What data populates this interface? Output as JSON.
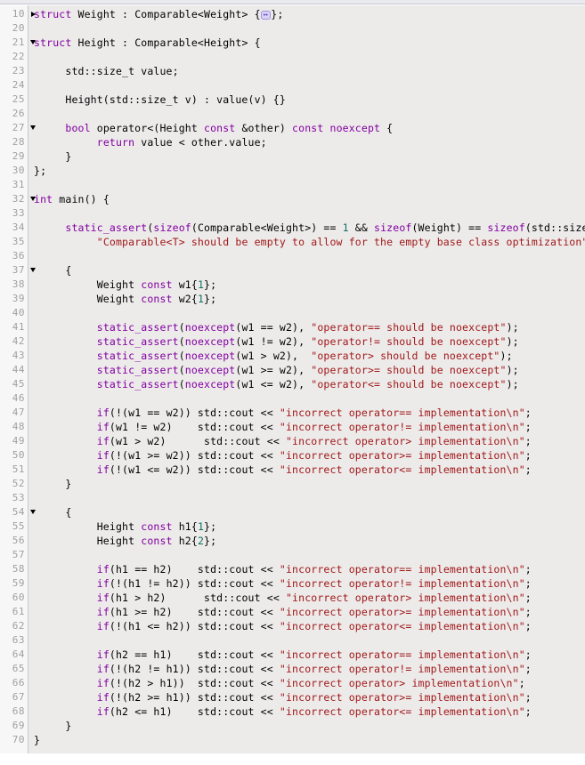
{
  "editor": {
    "language": "C++",
    "gutter_bg": "#f7f7f7",
    "code_bg": "#edeaea",
    "keyword_color": "#8000a0",
    "string_color": "#a01818",
    "number_color": "#0b7360",
    "plain_color": "#000000",
    "line_number_color": "#a0a0a0",
    "fold_chip_glyph": "↔"
  },
  "lines": [
    {
      "n": "10",
      "fold": "collapsed",
      "tokens": [
        {
          "t": "kw",
          "s": "struct"
        },
        {
          "t": "pl",
          "s": " Weight : Comparable<Weight> {"
        },
        {
          "t": "foldchip",
          "s": "↔"
        },
        {
          "t": "pl",
          "s": "};"
        }
      ]
    },
    {
      "n": "20",
      "fold": "none",
      "tokens": []
    },
    {
      "n": "21",
      "fold": "expanded",
      "tokens": [
        {
          "t": "kw",
          "s": "struct"
        },
        {
          "t": "pl",
          "s": " Height : Comparable<Height> {"
        }
      ]
    },
    {
      "n": "22",
      "fold": "none",
      "tokens": []
    },
    {
      "n": "23",
      "fold": "none",
      "tokens": [
        {
          "t": "pl",
          "s": "     std::size_t value;"
        }
      ]
    },
    {
      "n": "24",
      "fold": "none",
      "tokens": []
    },
    {
      "n": "25",
      "fold": "none",
      "tokens": [
        {
          "t": "pl",
          "s": "     Height(std::size_t v) : value(v) {}"
        }
      ]
    },
    {
      "n": "26",
      "fold": "none",
      "tokens": []
    },
    {
      "n": "27",
      "fold": "expanded",
      "tokens": [
        {
          "t": "pl",
          "s": "     "
        },
        {
          "t": "kw",
          "s": "bool"
        },
        {
          "t": "pl",
          "s": " operator<(Height "
        },
        {
          "t": "kw",
          "s": "const"
        },
        {
          "t": "pl",
          "s": " &other) "
        },
        {
          "t": "kw",
          "s": "const"
        },
        {
          "t": "pl",
          "s": " "
        },
        {
          "t": "kw",
          "s": "noexcept"
        },
        {
          "t": "pl",
          "s": " {"
        }
      ]
    },
    {
      "n": "28",
      "fold": "none",
      "tokens": [
        {
          "t": "pl",
          "s": "          "
        },
        {
          "t": "kw",
          "s": "return"
        },
        {
          "t": "pl",
          "s": " value < other.value;"
        }
      ]
    },
    {
      "n": "29",
      "fold": "none",
      "tokens": [
        {
          "t": "pl",
          "s": "     }"
        }
      ]
    },
    {
      "n": "30",
      "fold": "none",
      "tokens": [
        {
          "t": "pl",
          "s": "};"
        }
      ]
    },
    {
      "n": "31",
      "fold": "none",
      "tokens": []
    },
    {
      "n": "32",
      "fold": "expanded",
      "tokens": [
        {
          "t": "kw",
          "s": "int"
        },
        {
          "t": "pl",
          "s": " main() {"
        }
      ]
    },
    {
      "n": "33",
      "fold": "none",
      "tokens": []
    },
    {
      "n": "34",
      "fold": "none",
      "tokens": [
        {
          "t": "pl",
          "s": "     "
        },
        {
          "t": "kw",
          "s": "static_assert"
        },
        {
          "t": "pl",
          "s": "("
        },
        {
          "t": "kw",
          "s": "sizeof"
        },
        {
          "t": "pl",
          "s": "(Comparable<Weight>) == "
        },
        {
          "t": "num",
          "s": "1"
        },
        {
          "t": "pl",
          "s": " && "
        },
        {
          "t": "kw",
          "s": "sizeof"
        },
        {
          "t": "pl",
          "s": "(Weight) == "
        },
        {
          "t": "kw",
          "s": "sizeof"
        },
        {
          "t": "pl",
          "s": "(std::size_t),"
        }
      ]
    },
    {
      "n": "35",
      "fold": "none",
      "tokens": [
        {
          "t": "pl",
          "s": "          "
        },
        {
          "t": "str",
          "s": "\"Comparable<T> should be empty to allow for the empty base class optimization\""
        },
        {
          "t": "pl",
          "s": ");"
        }
      ]
    },
    {
      "n": "36",
      "fold": "none",
      "tokens": []
    },
    {
      "n": "37",
      "fold": "expanded",
      "tokens": [
        {
          "t": "pl",
          "s": "     {"
        }
      ]
    },
    {
      "n": "38",
      "fold": "none",
      "tokens": [
        {
          "t": "pl",
          "s": "          Weight "
        },
        {
          "t": "kw",
          "s": "const"
        },
        {
          "t": "pl",
          "s": " w1{"
        },
        {
          "t": "num",
          "s": "1"
        },
        {
          "t": "pl",
          "s": "};"
        }
      ]
    },
    {
      "n": "39",
      "fold": "none",
      "tokens": [
        {
          "t": "pl",
          "s": "          Weight "
        },
        {
          "t": "kw",
          "s": "const"
        },
        {
          "t": "pl",
          "s": " w2{"
        },
        {
          "t": "num",
          "s": "1"
        },
        {
          "t": "pl",
          "s": "};"
        }
      ]
    },
    {
      "n": "40",
      "fold": "none",
      "tokens": []
    },
    {
      "n": "41",
      "fold": "none",
      "tokens": [
        {
          "t": "pl",
          "s": "          "
        },
        {
          "t": "kw",
          "s": "static_assert"
        },
        {
          "t": "pl",
          "s": "("
        },
        {
          "t": "kw",
          "s": "noexcept"
        },
        {
          "t": "pl",
          "s": "(w1 == w2), "
        },
        {
          "t": "str",
          "s": "\"operator== should be noexcept\""
        },
        {
          "t": "pl",
          "s": ");"
        }
      ]
    },
    {
      "n": "42",
      "fold": "none",
      "tokens": [
        {
          "t": "pl",
          "s": "          "
        },
        {
          "t": "kw",
          "s": "static_assert"
        },
        {
          "t": "pl",
          "s": "("
        },
        {
          "t": "kw",
          "s": "noexcept"
        },
        {
          "t": "pl",
          "s": "(w1 != w2), "
        },
        {
          "t": "str",
          "s": "\"operator!= should be noexcept\""
        },
        {
          "t": "pl",
          "s": ");"
        }
      ]
    },
    {
      "n": "43",
      "fold": "none",
      "tokens": [
        {
          "t": "pl",
          "s": "          "
        },
        {
          "t": "kw",
          "s": "static_assert"
        },
        {
          "t": "pl",
          "s": "("
        },
        {
          "t": "kw",
          "s": "noexcept"
        },
        {
          "t": "pl",
          "s": "(w1 > w2),  "
        },
        {
          "t": "str",
          "s": "\"operator> should be noexcept\""
        },
        {
          "t": "pl",
          "s": ");"
        }
      ]
    },
    {
      "n": "44",
      "fold": "none",
      "tokens": [
        {
          "t": "pl",
          "s": "          "
        },
        {
          "t": "kw",
          "s": "static_assert"
        },
        {
          "t": "pl",
          "s": "("
        },
        {
          "t": "kw",
          "s": "noexcept"
        },
        {
          "t": "pl",
          "s": "(w1 >= w2), "
        },
        {
          "t": "str",
          "s": "\"operator>= should be noexcept\""
        },
        {
          "t": "pl",
          "s": ");"
        }
      ]
    },
    {
      "n": "45",
      "fold": "none",
      "tokens": [
        {
          "t": "pl",
          "s": "          "
        },
        {
          "t": "kw",
          "s": "static_assert"
        },
        {
          "t": "pl",
          "s": "("
        },
        {
          "t": "kw",
          "s": "noexcept"
        },
        {
          "t": "pl",
          "s": "(w1 <= w2), "
        },
        {
          "t": "str",
          "s": "\"operator<= should be noexcept\""
        },
        {
          "t": "pl",
          "s": ");"
        }
      ]
    },
    {
      "n": "46",
      "fold": "none",
      "tokens": []
    },
    {
      "n": "47",
      "fold": "none",
      "tokens": [
        {
          "t": "pl",
          "s": "          "
        },
        {
          "t": "kw",
          "s": "if"
        },
        {
          "t": "pl",
          "s": "(!(w1 == w2)) std::cout << "
        },
        {
          "t": "str",
          "s": "\"incorrect operator== implementation\\n\""
        },
        {
          "t": "pl",
          "s": ";"
        }
      ]
    },
    {
      "n": "48",
      "fold": "none",
      "tokens": [
        {
          "t": "pl",
          "s": "          "
        },
        {
          "t": "kw",
          "s": "if"
        },
        {
          "t": "pl",
          "s": "(w1 != w2)    std::cout << "
        },
        {
          "t": "str",
          "s": "\"incorrect operator!= implementation\\n\""
        },
        {
          "t": "pl",
          "s": ";"
        }
      ]
    },
    {
      "n": "49",
      "fold": "none",
      "tokens": [
        {
          "t": "pl",
          "s": "          "
        },
        {
          "t": "kw",
          "s": "if"
        },
        {
          "t": "pl",
          "s": "(w1 > w2)      std::cout << "
        },
        {
          "t": "str",
          "s": "\"incorrect operator> implementation\\n\""
        },
        {
          "t": "pl",
          "s": ";"
        }
      ]
    },
    {
      "n": "50",
      "fold": "none",
      "tokens": [
        {
          "t": "pl",
          "s": "          "
        },
        {
          "t": "kw",
          "s": "if"
        },
        {
          "t": "pl",
          "s": "(!(w1 >= w2)) std::cout << "
        },
        {
          "t": "str",
          "s": "\"incorrect operator>= implementation\\n\""
        },
        {
          "t": "pl",
          "s": ";"
        }
      ]
    },
    {
      "n": "51",
      "fold": "none",
      "tokens": [
        {
          "t": "pl",
          "s": "          "
        },
        {
          "t": "kw",
          "s": "if"
        },
        {
          "t": "pl",
          "s": "(!(w1 <= w2)) std::cout << "
        },
        {
          "t": "str",
          "s": "\"incorrect operator<= implementation\\n\""
        },
        {
          "t": "pl",
          "s": ";"
        }
      ]
    },
    {
      "n": "52",
      "fold": "none",
      "tokens": [
        {
          "t": "pl",
          "s": "     }"
        }
      ]
    },
    {
      "n": "53",
      "fold": "none",
      "tokens": []
    },
    {
      "n": "54",
      "fold": "expanded",
      "tokens": [
        {
          "t": "pl",
          "s": "     {"
        }
      ]
    },
    {
      "n": "55",
      "fold": "none",
      "tokens": [
        {
          "t": "pl",
          "s": "          Height "
        },
        {
          "t": "kw",
          "s": "const"
        },
        {
          "t": "pl",
          "s": " h1{"
        },
        {
          "t": "num",
          "s": "1"
        },
        {
          "t": "pl",
          "s": "};"
        }
      ]
    },
    {
      "n": "56",
      "fold": "none",
      "tokens": [
        {
          "t": "pl",
          "s": "          Height "
        },
        {
          "t": "kw",
          "s": "const"
        },
        {
          "t": "pl",
          "s": " h2{"
        },
        {
          "t": "num",
          "s": "2"
        },
        {
          "t": "pl",
          "s": "};"
        }
      ]
    },
    {
      "n": "57",
      "fold": "none",
      "tokens": []
    },
    {
      "n": "58",
      "fold": "none",
      "tokens": [
        {
          "t": "pl",
          "s": "          "
        },
        {
          "t": "kw",
          "s": "if"
        },
        {
          "t": "pl",
          "s": "(h1 == h2)    std::cout << "
        },
        {
          "t": "str",
          "s": "\"incorrect operator== implementation\\n\""
        },
        {
          "t": "pl",
          "s": ";"
        }
      ]
    },
    {
      "n": "59",
      "fold": "none",
      "tokens": [
        {
          "t": "pl",
          "s": "          "
        },
        {
          "t": "kw",
          "s": "if"
        },
        {
          "t": "pl",
          "s": "(!(h1 != h2)) std::cout << "
        },
        {
          "t": "str",
          "s": "\"incorrect operator!= implementation\\n\""
        },
        {
          "t": "pl",
          "s": ";"
        }
      ]
    },
    {
      "n": "60",
      "fold": "none",
      "tokens": [
        {
          "t": "pl",
          "s": "          "
        },
        {
          "t": "kw",
          "s": "if"
        },
        {
          "t": "pl",
          "s": "(h1 > h2)      std::cout << "
        },
        {
          "t": "str",
          "s": "\"incorrect operator> implementation\\n\""
        },
        {
          "t": "pl",
          "s": ";"
        }
      ]
    },
    {
      "n": "61",
      "fold": "none",
      "tokens": [
        {
          "t": "pl",
          "s": "          "
        },
        {
          "t": "kw",
          "s": "if"
        },
        {
          "t": "pl",
          "s": "(h1 >= h2)    std::cout << "
        },
        {
          "t": "str",
          "s": "\"incorrect operator>= implementation\\n\""
        },
        {
          "t": "pl",
          "s": ";"
        }
      ]
    },
    {
      "n": "62",
      "fold": "none",
      "tokens": [
        {
          "t": "pl",
          "s": "          "
        },
        {
          "t": "kw",
          "s": "if"
        },
        {
          "t": "pl",
          "s": "(!(h1 <= h2)) std::cout << "
        },
        {
          "t": "str",
          "s": "\"incorrect operator<= implementation\\n\""
        },
        {
          "t": "pl",
          "s": ";"
        }
      ]
    },
    {
      "n": "63",
      "fold": "none",
      "tokens": []
    },
    {
      "n": "64",
      "fold": "none",
      "tokens": [
        {
          "t": "pl",
          "s": "          "
        },
        {
          "t": "kw",
          "s": "if"
        },
        {
          "t": "pl",
          "s": "(h2 == h1)    std::cout << "
        },
        {
          "t": "str",
          "s": "\"incorrect operator== implementation\\n\""
        },
        {
          "t": "pl",
          "s": ";"
        }
      ]
    },
    {
      "n": "65",
      "fold": "none",
      "tokens": [
        {
          "t": "pl",
          "s": "          "
        },
        {
          "t": "kw",
          "s": "if"
        },
        {
          "t": "pl",
          "s": "(!(h2 != h1)) std::cout << "
        },
        {
          "t": "str",
          "s": "\"incorrect operator!= implementation\\n\""
        },
        {
          "t": "pl",
          "s": ";"
        }
      ]
    },
    {
      "n": "66",
      "fold": "none",
      "tokens": [
        {
          "t": "pl",
          "s": "          "
        },
        {
          "t": "kw",
          "s": "if"
        },
        {
          "t": "pl",
          "s": "(!(h2 > h1))  std::cout << "
        },
        {
          "t": "str",
          "s": "\"incorrect operator> implementation\\n\""
        },
        {
          "t": "pl",
          "s": ";"
        }
      ]
    },
    {
      "n": "67",
      "fold": "none",
      "tokens": [
        {
          "t": "pl",
          "s": "          "
        },
        {
          "t": "kw",
          "s": "if"
        },
        {
          "t": "pl",
          "s": "(!(h2 >= h1)) std::cout << "
        },
        {
          "t": "str",
          "s": "\"incorrect operator>= implementation\\n\""
        },
        {
          "t": "pl",
          "s": ";"
        }
      ]
    },
    {
      "n": "68",
      "fold": "none",
      "tokens": [
        {
          "t": "pl",
          "s": "          "
        },
        {
          "t": "kw",
          "s": "if"
        },
        {
          "t": "pl",
          "s": "(h2 <= h1)    std::cout << "
        },
        {
          "t": "str",
          "s": "\"incorrect operator<= implementation\\n\""
        },
        {
          "t": "pl",
          "s": ";"
        }
      ]
    },
    {
      "n": "69",
      "fold": "none",
      "tokens": [
        {
          "t": "pl",
          "s": "     }"
        }
      ]
    },
    {
      "n": "70",
      "fold": "none",
      "tokens": [
        {
          "t": "pl",
          "s": "}"
        }
      ]
    }
  ]
}
